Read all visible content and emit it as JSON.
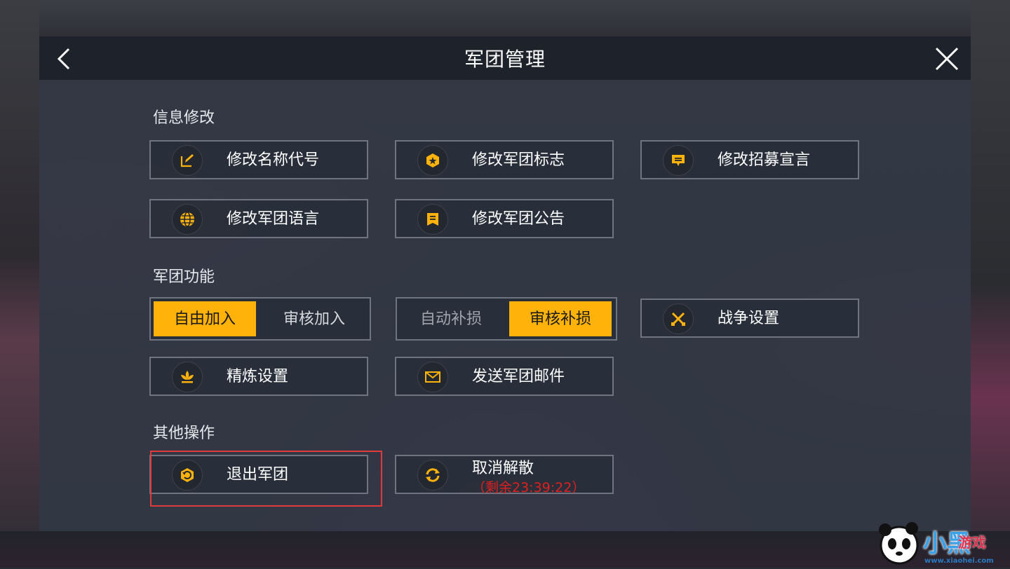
{
  "header": {
    "title": "军团管理",
    "back_icon": "chevron-left-icon",
    "close_icon": "close-icon"
  },
  "sections": {
    "info": {
      "title": "信息修改",
      "buttons": [
        {
          "label": "修改名称代号",
          "icon": "edit-icon"
        },
        {
          "label": "修改军团标志",
          "icon": "emblem-icon"
        },
        {
          "label": "修改招募宣言",
          "icon": "message-icon"
        },
        {
          "label": "修改军团语言",
          "icon": "globe-icon"
        },
        {
          "label": "修改军团公告",
          "icon": "notice-icon"
        }
      ]
    },
    "functions": {
      "title": "军团功能",
      "join_toggle": {
        "options": [
          "自由加入",
          "审核加入"
        ],
        "selected": "自由加入"
      },
      "repair_toggle": {
        "options": [
          "自动补损",
          "审核补损"
        ],
        "selected": "审核补损"
      },
      "buttons": [
        {
          "label": "战争设置",
          "icon": "swords-icon"
        },
        {
          "label": "精炼设置",
          "icon": "lotus-icon"
        },
        {
          "label": "发送军团邮件",
          "icon": "mail-icon"
        }
      ]
    },
    "other": {
      "title": "其他操作",
      "buttons": [
        {
          "label": "退出军团",
          "icon": "exit-icon"
        },
        {
          "label": "取消解散",
          "sublabel": "（剩余23:39:22）",
          "icon": "refresh-icon"
        }
      ]
    }
  },
  "colors": {
    "accent": "#ffb20a",
    "highlight_border": "#e03a3a",
    "countdown": "#e02020"
  },
  "watermark": {
    "text": "小黑",
    "text2": "游戏",
    "url": "www.xiaohei.com"
  }
}
